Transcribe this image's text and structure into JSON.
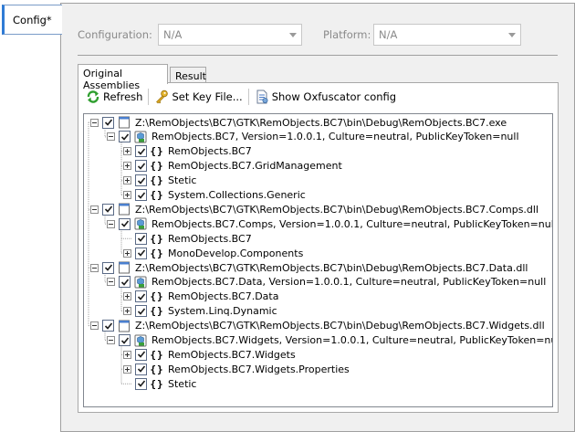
{
  "sidebar": {
    "tab_label": "Config*"
  },
  "config": {
    "configuration_label": "Configuration:",
    "configuration_value": "N/A",
    "platform_label": "Platform:",
    "platform_value": "N/A"
  },
  "tabs": [
    {
      "label": "Original Assemblies",
      "active": true
    },
    {
      "label": "Result",
      "active": false
    }
  ],
  "toolbar": {
    "refresh": "Refresh",
    "set_key_file": "Set Key File...",
    "show_config": "Show Oxfuscator config"
  },
  "tree": [
    {
      "depth": 0,
      "expander": "minus",
      "icon": "file-icon",
      "text": "Z:\\RemObjects\\BC7\\GTK\\RemObjects.BC7\\bin\\Debug\\RemObjects.BC7.exe"
    },
    {
      "depth": 1,
      "expander": "minus",
      "icon": "assembly-icon",
      "text": "RemObjects.BC7, Version=1.0.0.1, Culture=neutral, PublicKeyToken=null"
    },
    {
      "depth": 2,
      "expander": "plus",
      "icon": "namespace-icon",
      "text": "RemObjects.BC7"
    },
    {
      "depth": 2,
      "expander": "plus",
      "icon": "namespace-icon",
      "text": "RemObjects.BC7.GridManagement"
    },
    {
      "depth": 2,
      "expander": "plus",
      "icon": "namespace-icon",
      "text": "Stetic"
    },
    {
      "depth": 2,
      "expander": "plus",
      "icon": "namespace-icon",
      "text": "System.Collections.Generic"
    },
    {
      "depth": 0,
      "expander": "minus",
      "icon": "file-icon",
      "text": "Z:\\RemObjects\\BC7\\GTK\\RemObjects.BC7\\bin\\Debug\\RemObjects.BC7.Comps.dll"
    },
    {
      "depth": 1,
      "expander": "minus",
      "icon": "assembly-icon",
      "text": "RemObjects.BC7.Comps, Version=1.0.0.1, Culture=neutral, PublicKeyToken=null"
    },
    {
      "depth": 2,
      "expander": "none",
      "icon": "namespace-icon",
      "text": "RemObjects.BC7"
    },
    {
      "depth": 2,
      "expander": "plus",
      "icon": "namespace-icon",
      "text": "MonoDevelop.Components"
    },
    {
      "depth": 0,
      "expander": "minus",
      "icon": "file-icon",
      "text": "Z:\\RemObjects\\BC7\\GTK\\RemObjects.BC7\\bin\\Debug\\RemObjects.BC7.Data.dll"
    },
    {
      "depth": 1,
      "expander": "minus",
      "icon": "assembly-icon",
      "text": "RemObjects.BC7.Data, Version=1.0.0.1, Culture=neutral, PublicKeyToken=null"
    },
    {
      "depth": 2,
      "expander": "plus",
      "icon": "namespace-icon",
      "text": "RemObjects.BC7.Data"
    },
    {
      "depth": 2,
      "expander": "plus",
      "icon": "namespace-icon",
      "text": "System.Linq.Dynamic"
    },
    {
      "depth": 0,
      "expander": "minus",
      "icon": "file-icon",
      "text": "Z:\\RemObjects\\BC7\\GTK\\RemObjects.BC7\\bin\\Debug\\RemObjects.BC7.Widgets.dll"
    },
    {
      "depth": 1,
      "expander": "minus",
      "icon": "assembly-icon",
      "text": "RemObjects.BC7.Widgets, Version=1.0.0.1, Culture=neutral, PublicKeyToken=null"
    },
    {
      "depth": 2,
      "expander": "plus",
      "icon": "namespace-icon",
      "text": "RemObjects.BC7.Widgets"
    },
    {
      "depth": 2,
      "expander": "plus",
      "icon": "namespace-icon",
      "text": "RemObjects.BC7.Widgets.Properties"
    },
    {
      "depth": 2,
      "expander": "none",
      "icon": "namespace-icon",
      "text": "Stetic"
    }
  ],
  "colors": {
    "tab_accent": "#2f7bd5",
    "refresh_green": "#2e9e2e",
    "key_gold": "#d9a520"
  }
}
